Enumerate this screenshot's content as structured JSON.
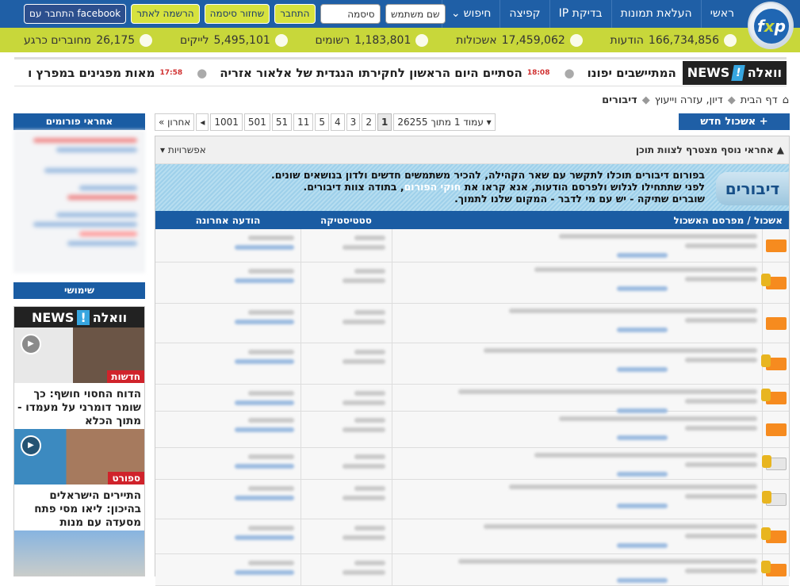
{
  "header": {
    "logo": "fxp",
    "nav": [
      "ראשי",
      "העלאת תמונות",
      "בדיקת IP",
      "קפיצה",
      "חיפוש"
    ],
    "login": {
      "username_placeholder": "שם משתמש",
      "password_placeholder": "סיסמה",
      "login": "התחבר",
      "forgot": "שחזור סיסמה",
      "register": "הרשמה לאתר",
      "facebook": "התחבר עם facebook"
    }
  },
  "stats": [
    {
      "value": "166,734,856",
      "label": "הודעות",
      "icon": "speech-icon"
    },
    {
      "value": "17,459,062",
      "label": "אשכולות",
      "icon": "document-icon"
    },
    {
      "value": "1,183,801",
      "label": "רשומים",
      "icon": "users-icon"
    },
    {
      "value": "5,495,101",
      "label": "לייקים",
      "icon": "heart-icon"
    },
    {
      "value": "26,175",
      "label": "מחוברים כרגע",
      "icon": "signal-icon"
    }
  ],
  "ticker": {
    "brand": "וואלה",
    "brand_news": "NEWS",
    "items": [
      {
        "time": "",
        "text": "המתיישבים יפונו"
      },
      {
        "time": "18:08",
        "text": "הסתיים היום הראשון לחקירתו הנגדית של אלאור אזריה"
      },
      {
        "time": "17:58",
        "text": "מאות מפגינים במפרץ ו"
      }
    ]
  },
  "breadcrumb": [
    "דף הבית",
    "דיון, עזרה וייעוץ",
    "דיבורים"
  ],
  "new_thread": "+ אשכול חדש",
  "pager": {
    "label": "עמוד 1 מתוך 26255",
    "pages": [
      "1",
      "2",
      "3",
      "4",
      "5",
      "11",
      "51",
      "501",
      "1001"
    ],
    "current": "1",
    "last": "אחרון"
  },
  "forum": {
    "announcement": "אחראי נוסף מצטרף לצוות תוכן",
    "options": "אפשרויות",
    "banner_title": "דיבורים",
    "banner_lines": [
      "בפורום דיבורים תוכלו לתקשר עם שאר הקהילה, להכיר משתמשים חדשים ולדון בנושאים שונים.",
      "לפני שתתחילו לגלוש ולפרסם הודעות, אנא קראו את",
      "חוקי הפורום",
      ", בתודה צוות דיבורים.",
      "שוברים שתיקה - יש עם מי לדבר - המקום שלנו לתמוך."
    ],
    "columns": [
      "אשכול / מפרסם האשכול",
      "סטטיסטיקה",
      "הודעה אחרונה"
    ],
    "rows": [
      {
        "icon": "open"
      },
      {
        "icon": "locked"
      },
      {
        "icon": "open"
      },
      {
        "icon": "locked"
      },
      {
        "icon": "locked"
      },
      {
        "icon": "open"
      },
      {
        "icon": "locked-read"
      },
      {
        "icon": "locked-read"
      },
      {
        "icon": "locked"
      },
      {
        "icon": "locked"
      }
    ]
  },
  "sidebar": {
    "moderators_title": "אחראי פורומים",
    "useful_title": "שימושי",
    "news": {
      "brand": "וואלה",
      "brand_news": "NEWS",
      "items": [
        {
          "category": "חדשות",
          "title": "הדוח החסוי חושף: כך שומר דומרני על מעמדו - מתוך הכלא"
        },
        {
          "category": "ספורט",
          "title": "התיירים הישראלים בהיכון: ליאו מסי פתח מסעדה עם מנות מיוחדות"
        }
      ]
    }
  }
}
